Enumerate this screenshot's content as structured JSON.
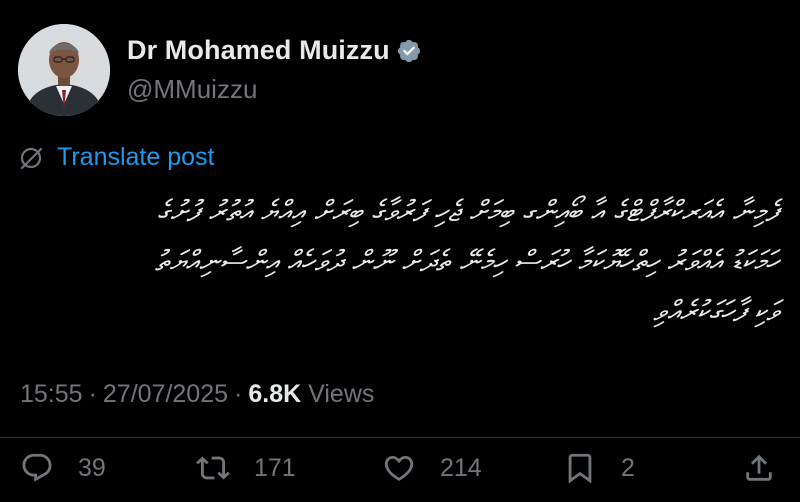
{
  "author": {
    "display_name": "Dr Mohamed Muizzu",
    "handle": "@MMuizzu",
    "verified_badge": "verified-badge-icon"
  },
  "translate": {
    "label": "Translate post",
    "icon": "globe-slash-icon",
    "color": "#1d9bf0"
  },
  "tweet": {
    "lines": [
      "ފެމިނާ އެއަރކްރާފްޓްގެ އާ ބޯއިންގ ބިމަށް ޖެހި ފަރުވާގެ ބިރަށް އިއްޔެ އުތުރު ފުށުގެ",
      "ހަމަކަޑު އެއްވަރު ހިތްހެޔޮކަމާ ހުރަސް ހިމެނޭ ތެދަށް ނޫން ދުވަހެއް އިންސާނިއްޔަތު",
      "ވަކި ފާހަގަކުރެއްވި"
    ]
  },
  "meta": {
    "time": "15:55",
    "date": "27/07/2025",
    "views_count": "6.8K",
    "views_label": "Views",
    "separator": "·"
  },
  "actions": {
    "reply_count": "39",
    "repost_count": "171",
    "like_count": "214",
    "bookmark_count": "2"
  },
  "colors": {
    "background": "#000000",
    "text_primary": "#e7e9ea",
    "text_secondary": "#71767b",
    "accent": "#1d9bf0",
    "divider": "#2f3336"
  }
}
